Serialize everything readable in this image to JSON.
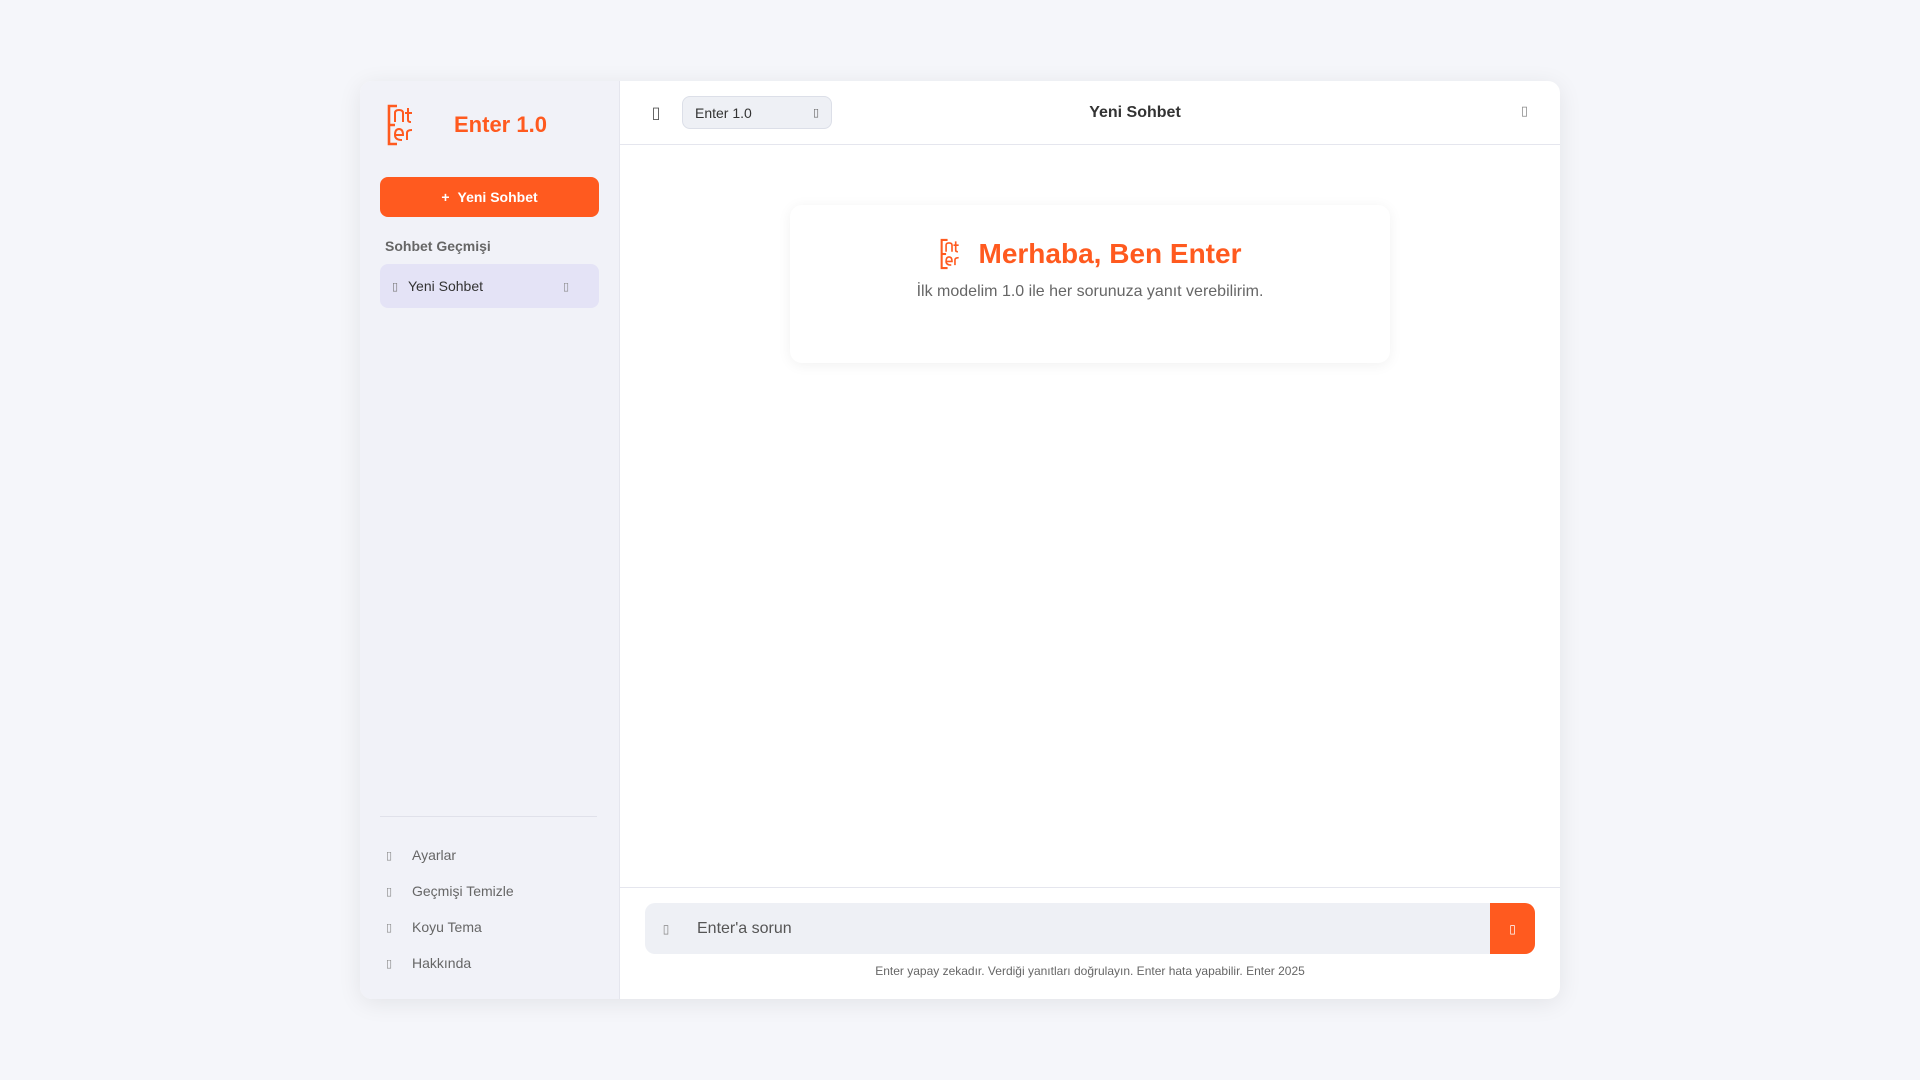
{
  "app": {
    "brand_title": "Enter 1.0"
  },
  "sidebar": {
    "new_chat_label": "Yeni Sohbet",
    "history_title": "Sohbet Geçmişi",
    "history_items": [
      {
        "label": "Yeni Sohbet"
      }
    ],
    "menu": [
      {
        "label": "Ayarlar"
      },
      {
        "label": "Geçmişi Temizle"
      },
      {
        "label": "Koyu Tema"
      },
      {
        "label": "Hakkında"
      }
    ]
  },
  "header": {
    "model_selected": "Enter 1.0",
    "title": "Yeni Sohbet"
  },
  "welcome": {
    "title": "Merhaba, Ben Enter",
    "subtitle": "İlk modelim 1.0 ile her sorunuza yanıt verebilirim."
  },
  "input": {
    "placeholder": "Enter'a sorun",
    "value": ""
  },
  "footer": {
    "disclaimer": "Enter yapay zekadır. Verdiği yanıtları doğrulayın. Enter hata yapabilir. Enter 2025"
  },
  "colors": {
    "accent": "#ff5a1f",
    "sidebar_bg": "#f1f2f8",
    "active_item_bg": "#e4e3f6"
  },
  "icons": {
    "logo": "enter-logo",
    "menu_toggle": "menu-icon",
    "model_chevron": "chevron-down-icon",
    "topbar_right": "share-icon",
    "history_item": "chat-bubble-icon",
    "history_delete": "trash-icon",
    "settings": "gear-icon",
    "clear": "trash-icon",
    "theme": "moon-icon",
    "about": "info-icon",
    "attach": "paperclip-icon",
    "send": "send-icon"
  }
}
